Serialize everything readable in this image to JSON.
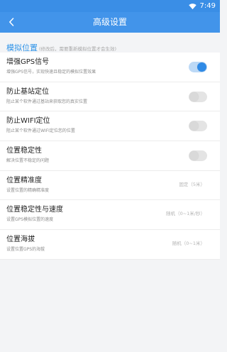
{
  "status_bar": {
    "time": "7:49",
    "icons": [
      "wifi-icon",
      "battery-icon"
    ]
  },
  "app_bar": {
    "title": "高级设置",
    "back_icon": "back-arrow-icon"
  },
  "section": {
    "title": "模拟位置",
    "note": "(修改后，需要重新模拟位置才会生效)"
  },
  "settings": [
    {
      "title": "增强GPS信号",
      "subtitle": "增强GPS信号，实现快速且稳定的模拟位置效果",
      "control": "toggle",
      "on": true
    },
    {
      "title": "防止基站定位",
      "subtitle": "阻止某个软件通过基站来获取您的真实位置",
      "control": "toggle",
      "on": false
    },
    {
      "title": "防止WIFI定位",
      "subtitle": "阻止某个软件通过WIFI定位您的位置",
      "control": "toggle",
      "on": false
    },
    {
      "title": "位置稳定性",
      "subtitle": "解决位置不稳定的问题",
      "control": "toggle",
      "on": false
    },
    {
      "title": "位置精准度",
      "subtitle": "设置位置的精确精准度",
      "control": "value",
      "value": "固定（5米）"
    },
    {
      "title": "位置稳定性与速度",
      "subtitle": "设置GPS模拟位置的速度",
      "control": "value",
      "value": "随机（0~1米/秒）"
    },
    {
      "title": "位置海拔",
      "subtitle": "设置位置GPS的海拔",
      "control": "value",
      "value": "随机（0~1米）"
    }
  ],
  "colors": {
    "accent": "#4294ea",
    "status_bar": "#3a8ee6",
    "switch_on": "#2f8ae6",
    "section_title": "#2f93e8"
  }
}
